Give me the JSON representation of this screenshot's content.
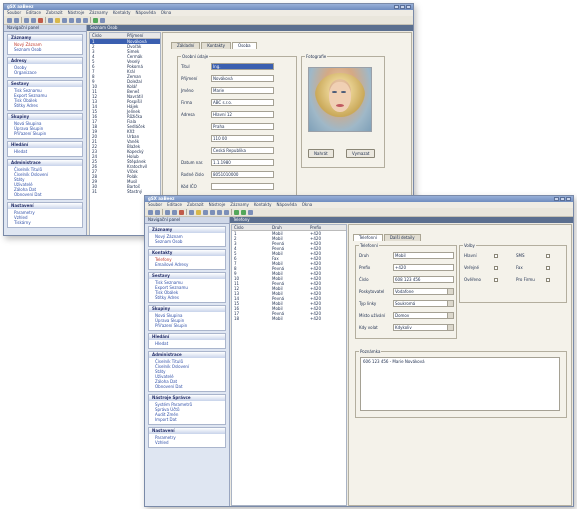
{
  "back_window": {
    "title": "gSX aaBeez",
    "menu": [
      "Soubor",
      "Editace",
      "Zobrazit",
      "Nástroje",
      "Záznamy",
      "Kontakty",
      "Nápověda",
      "Okna"
    ],
    "nav_header": "Navigační panel",
    "nav_groups": [
      {
        "title": "Záznamy",
        "items": [
          {
            "label": "Nový Záznam",
            "red": true
          },
          {
            "label": "Seznam Osob",
            "red": false
          }
        ]
      },
      {
        "title": "Adresy",
        "items": [
          {
            "label": "Osoby",
            "red": false
          },
          {
            "label": "Organizace",
            "red": false
          }
        ]
      },
      {
        "title": "Sestavy",
        "items": [
          {
            "label": "Tisk Seznamu",
            "red": false
          },
          {
            "label": "Export Seznamu",
            "red": false
          },
          {
            "label": "Tisk Obálek",
            "red": false
          },
          {
            "label": "Štítky Adres",
            "red": false
          }
        ]
      },
      {
        "title": "Skupiny",
        "items": [
          {
            "label": "Nová Skupina",
            "red": false
          },
          {
            "label": "Úprava Skupin",
            "red": false
          },
          {
            "label": "Přiřazení Skupin",
            "red": false
          }
        ]
      },
      {
        "title": "Hledání",
        "items": [
          {
            "label": "Hledat",
            "red": false
          }
        ]
      },
      {
        "title": "Administrace",
        "items": [
          {
            "label": "Číselník Titulů",
            "red": false
          },
          {
            "label": "Číselník Oslovení",
            "red": false
          },
          {
            "label": "Státy",
            "red": false
          },
          {
            "label": "Uživatelé",
            "red": false
          },
          {
            "label": "Záloha Dat",
            "red": false
          },
          {
            "label": "Obnovení Dat",
            "red": false
          }
        ]
      },
      {
        "title": "Nastavení",
        "items": [
          {
            "label": "Parametry",
            "red": false
          },
          {
            "label": "Vzhled",
            "red": false
          },
          {
            "label": "Tiskárny",
            "red": false
          }
        ]
      }
    ],
    "panel_header": "Seznam Osob",
    "list_columns": [
      "Číslo",
      "Příjmení"
    ],
    "list_rows": [
      [
        "1",
        "Nováková"
      ],
      [
        "2",
        "Dvořák"
      ],
      [
        "3",
        "Šimek"
      ],
      [
        "4",
        "Čermák"
      ],
      [
        "5",
        "Veselý"
      ],
      [
        "6",
        "Pokorná"
      ],
      [
        "7",
        "Král"
      ],
      [
        "8",
        "Zeman"
      ],
      [
        "9",
        "Doležal"
      ],
      [
        "10",
        "Kolář"
      ],
      [
        "11",
        "Beneš"
      ],
      [
        "12",
        "Navrátil"
      ],
      [
        "13",
        "Pospíšil"
      ],
      [
        "14",
        "Hájek"
      ],
      [
        "15",
        "Jelínek"
      ],
      [
        "16",
        "Růžička"
      ],
      [
        "17",
        "Fiala"
      ],
      [
        "18",
        "Sedláček"
      ],
      [
        "19",
        "Kříž"
      ],
      [
        "20",
        "Urban"
      ],
      [
        "21",
        "Vaněk"
      ],
      [
        "22",
        "Blažek"
      ],
      [
        "23",
        "Kopecký"
      ],
      [
        "24",
        "Holub"
      ],
      [
        "25",
        "Štěpánek"
      ],
      [
        "26",
        "Kratochvíl"
      ],
      [
        "27",
        "Vlček"
      ],
      [
        "28",
        "Polák"
      ],
      [
        "29",
        "Musil"
      ],
      [
        "30",
        "Bartoš"
      ],
      [
        "31",
        "Šťastný"
      ]
    ],
    "tabs": [
      "Základní",
      "Kontakty",
      "Osoba"
    ],
    "form_group_title": "Osobní údaje",
    "fields": [
      {
        "label": "Titul",
        "value": "Ing."
      },
      {
        "label": "Příjmení",
        "value": "Nováková"
      },
      {
        "label": "Jméno",
        "value": "Marie"
      },
      {
        "label": "Firma",
        "value": "ABC s.r.o."
      },
      {
        "label": "Adresa",
        "value": "Hlavní 12"
      },
      {
        "label": "",
        "value": "Praha"
      },
      {
        "label": "",
        "value": "110 00"
      },
      {
        "label": "",
        "value": "Česká Republika"
      },
      {
        "label": "Datum nar.",
        "value": "1.1.1980"
      },
      {
        "label": "Rodné číslo",
        "value": "8051010000"
      },
      {
        "label": "Kód IČO",
        "value": ""
      }
    ],
    "photo_group_title": "Fotografie",
    "buttons": [
      "Nahrát",
      "Vymazat"
    ]
  },
  "front_window": {
    "title": "gSX aaBeez",
    "menu": [
      "Soubor",
      "Editace",
      "Zobrazit",
      "Nástroje",
      "Záznamy",
      "Kontakty",
      "Nápověda",
      "Okna"
    ],
    "nav_header": "Navigační panel",
    "nav_groups": [
      {
        "title": "Záznamy",
        "items": [
          {
            "label": "Nový Záznam",
            "red": false
          },
          {
            "label": "Seznam Osob",
            "red": false
          }
        ]
      },
      {
        "title": "Kontakty",
        "items": [
          {
            "label": "Telefony",
            "red": true
          },
          {
            "label": "Emailové Adresy",
            "red": false
          }
        ]
      },
      {
        "title": "Sestavy",
        "items": [
          {
            "label": "Tisk Seznamu",
            "red": false
          },
          {
            "label": "Export Seznamu",
            "red": false
          },
          {
            "label": "Tisk Obálek",
            "red": false
          },
          {
            "label": "Štítky Adres",
            "red": false
          }
        ]
      },
      {
        "title": "Skupiny",
        "items": [
          {
            "label": "Nová Skupina",
            "red": false
          },
          {
            "label": "Úprava Skupin",
            "red": false
          },
          {
            "label": "Přiřazení Skupin",
            "red": false
          }
        ]
      },
      {
        "title": "Hledání",
        "items": [
          {
            "label": "Hledat",
            "red": false
          }
        ]
      },
      {
        "title": "Administrace",
        "items": [
          {
            "label": "Číselník Titulů",
            "red": false
          },
          {
            "label": "Číselník Oslovení",
            "red": false
          },
          {
            "label": "Státy",
            "red": false
          },
          {
            "label": "Uživatelé",
            "red": false
          },
          {
            "label": "Záloha Dat",
            "red": false
          },
          {
            "label": "Obnovení Dat",
            "red": false
          }
        ]
      },
      {
        "title": "Nástroje Správce",
        "items": [
          {
            "label": "Systém Parametrů",
            "red": false
          },
          {
            "label": "Správa Účtů",
            "red": false
          },
          {
            "label": "Audit Změn",
            "red": false
          },
          {
            "label": "Import Dat",
            "red": false
          }
        ]
      },
      {
        "title": "Nastavení",
        "items": [
          {
            "label": "Parametry",
            "red": false
          },
          {
            "label": "Vzhled",
            "red": false
          }
        ]
      }
    ],
    "panel_header": "Telefony",
    "list_columns": [
      "Číslo",
      "Druh",
      "Prefix"
    ],
    "list_rows": [
      [
        "1",
        "Mobil",
        "+420"
      ],
      [
        "2",
        "Mobil",
        "+420"
      ],
      [
        "3",
        "Pevná",
        "+420"
      ],
      [
        "4",
        "Pevná",
        "+420"
      ],
      [
        "5",
        "Mobil",
        "+420"
      ],
      [
        "6",
        "Fax",
        "+420"
      ],
      [
        "7",
        "Mobil",
        "+420"
      ],
      [
        "8",
        "Pevná",
        "+420"
      ],
      [
        "9",
        "Mobil",
        "+420"
      ],
      [
        "10",
        "Mobil",
        "+420"
      ],
      [
        "11",
        "Pevná",
        "+420"
      ],
      [
        "12",
        "Mobil",
        "+420"
      ],
      [
        "13",
        "Mobil",
        "+420"
      ],
      [
        "14",
        "Pevná",
        "+420"
      ],
      [
        "15",
        "Mobil",
        "+420"
      ],
      [
        "16",
        "Mobil",
        "+420"
      ],
      [
        "17",
        "Pevná",
        "+420"
      ],
      [
        "18",
        "Mobil",
        "+420"
      ]
    ],
    "tabs": [
      "Telefonní",
      "Další detaily"
    ],
    "form_group_title": "Telefonní",
    "fields": [
      {
        "label": "Druh",
        "value": "Mobil"
      },
      {
        "label": "Prefix",
        "value": "+420"
      },
      {
        "label": "Číslo",
        "value": "608 123 456"
      },
      {
        "label": "Poskytovatel",
        "value": "Vodafone"
      },
      {
        "label": "Typ linky",
        "value": "Soukromá"
      },
      {
        "label": "Místo užívání",
        "value": "Domov"
      },
      {
        "label": "Kdy volat",
        "value": "Kdykoliv"
      }
    ],
    "options_title": "Volby",
    "checks": [
      {
        "label": "Hlavní",
        "on": false
      },
      {
        "label": "SMS",
        "on": false
      },
      {
        "label": "Veřejné",
        "on": true
      },
      {
        "label": "Fax",
        "on": false
      },
      {
        "label": "Ověřeno",
        "on": true
      },
      {
        "label": "Pro Firmu",
        "on": false
      }
    ],
    "note_title": "Poznámka",
    "note_text": "606 123 456 - Marie Nováková"
  }
}
